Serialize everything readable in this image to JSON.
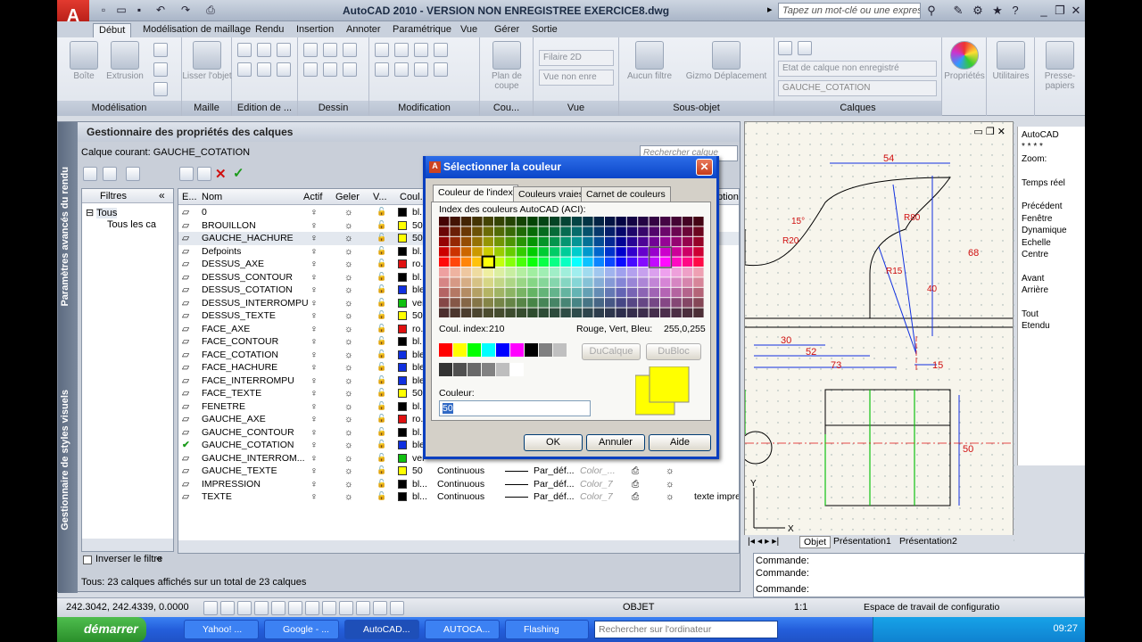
{
  "titlebar": {
    "title": "AutoCAD 2010 - VERSION NON ENREGISTREE    EXERCICE8.dwg",
    "search_placeholder": "Tapez un mot-clé ou une expressio"
  },
  "ribbon": {
    "tabs": [
      "Début",
      "Modélisation de maillage",
      "Rendu",
      "Insertion",
      "Annoter",
      "Paramétrique",
      "Vue",
      "Gérer",
      "Sortie"
    ],
    "buttons": {
      "boite": "Boîte",
      "extrusion": "Extrusion",
      "lisser": "Lisser l'objet",
      "plan_de_coupe": "Plan de coupe",
      "aucun_filtre": "Aucun filtre",
      "gizmo": "Gizmo Déplacement",
      "proprietes": "Propriétés",
      "utilitaires": "Utilitaires",
      "presse_papiers": "Presse-papiers"
    },
    "combos": {
      "style_visuel": "Filaire 2D",
      "vue": "Vue non enre",
      "etat_calque": "Etat de calque non enregistré",
      "calque_courant": "GAUCHE_COTATION"
    },
    "panels": [
      "Modélisation",
      "Maille",
      "Edition de ...",
      "Dessin",
      "Modification",
      "Cou...",
      "Vue",
      "Sous-objet",
      "Calques"
    ]
  },
  "layer_manager": {
    "side_labels": [
      "Paramètres avancés du rendu",
      "Gestionnaire de styles visuels"
    ],
    "title": "Gestionnaire des propriétés des calques",
    "current_layer": "Calque courant: GAUCHE_COTATION",
    "search_placeholder": "Rechercher calque",
    "filters_title": "Filtres",
    "filter_tree": [
      "Tous",
      "Tous les ca"
    ],
    "invert_filter": "Inverser le filtre",
    "columns": [
      "E...",
      "Nom",
      "Actif",
      "Geler",
      "V...",
      "Coul...",
      "",
      "",
      "",
      "",
      "ption"
    ],
    "rows": [
      {
        "name": "0",
        "color": "#000000",
        "color_label": "bl..."
      },
      {
        "name": "BROUILLON",
        "color": "#ffff00",
        "color_label": "50"
      },
      {
        "name": "GAUCHE_HACHURE",
        "color": "#ffff00",
        "color_label": "50"
      },
      {
        "name": "Defpoints",
        "color": "#000000",
        "color_label": "bl..."
      },
      {
        "name": "DESSUS_AXE",
        "color": "#e01010",
        "color_label": "ro..."
      },
      {
        "name": "DESSUS_CONTOUR",
        "color": "#000000",
        "color_label": "bl..."
      },
      {
        "name": "DESSUS_COTATION",
        "color": "#1030e0",
        "color_label": "ble"
      },
      {
        "name": "DESSUS_INTERROMPU",
        "color": "#10c010",
        "color_label": "ver"
      },
      {
        "name": "DESSUS_TEXTE",
        "color": "#ffff00",
        "color_label": "50"
      },
      {
        "name": "FACE_AXE",
        "color": "#e01010",
        "color_label": "ro..."
      },
      {
        "name": "FACE_CONTOUR",
        "color": "#000000",
        "color_label": "bl..."
      },
      {
        "name": "FACE_COTATION",
        "color": "#1030e0",
        "color_label": "ble"
      },
      {
        "name": "FACE_HACHURE",
        "color": "#1030e0",
        "color_label": "ble"
      },
      {
        "name": "FACE_INTERROMPU",
        "color": "#1030e0",
        "color_label": "ble"
      },
      {
        "name": "FACE_TEXTE",
        "color": "#ffff00",
        "color_label": "50"
      },
      {
        "name": "FENETRE",
        "color": "#000000",
        "color_label": "bl..."
      },
      {
        "name": "GAUCHE_AXE",
        "color": "#e01010",
        "color_label": "ro..."
      },
      {
        "name": "GAUCHE_CONTOUR",
        "color": "#000000",
        "color_label": "bl..."
      },
      {
        "name": "GAUCHE_COTATION",
        "color": "#1030e0",
        "color_label": "ble",
        "current": true
      },
      {
        "name": "GAUCHE_INTERROM...",
        "color": "#10c010",
        "color_label": "ver"
      },
      {
        "name": "GAUCHE_TEXTE",
        "color": "#ffff00",
        "color_label": "50",
        "linetype": "Continuous",
        "lineweight": "Par_déf...",
        "plotstyle": "Color_..."
      },
      {
        "name": "IMPRESSION",
        "color": "#000000",
        "color_label": "bl...",
        "linetype": "Continuous",
        "lineweight": "Par_déf...",
        "plotstyle": "Color_7"
      },
      {
        "name": "TEXTE",
        "color": "#000000",
        "color_label": "bl...",
        "linetype": "Continuous",
        "lineweight": "Par_déf...",
        "plotstyle": "Color_7",
        "description": "texte impre"
      }
    ],
    "status": "Tous: 23 calques affichés sur un total de 23 calques"
  },
  "dialog": {
    "title": "Sélectionner la couleur",
    "tabs": [
      "Couleur de l'index",
      "Couleurs vraies",
      "Carnet de couleurs"
    ],
    "index_label": "Index des couleurs AutoCAD (ACI):",
    "coul_index_label": "Coul. index:",
    "coul_index_value": "210",
    "rgb_label": "Rouge, Vert, Bleu:",
    "rgb_value": "255,0,255",
    "bylayer": "DuCalque",
    "byblock": "DuBloc",
    "couleur_label": "Couleur:",
    "couleur_value": "50",
    "ok": "OK",
    "cancel": "Annuler",
    "help": "Aide",
    "preview_color": "#ffff00"
  },
  "drawing": {
    "dims": [
      "54",
      "15°",
      "R20",
      "R80",
      "R15",
      "68",
      "40",
      "30",
      "52",
      "73",
      "15",
      "50"
    ],
    "ucs_x": "X",
    "ucs_y": "Y",
    "tabs": [
      "Objet",
      "Présentation1",
      "Présentation2"
    ]
  },
  "right_panel": [
    "AutoCAD",
    "* * * *",
    "Zoom:",
    "",
    "Temps réel",
    "",
    "Précédent",
    "Fenêtre",
    "Dynamique",
    "Echelle",
    "Centre",
    "",
    "Avant",
    "Arrière",
    "",
    "Tout",
    "Etendu"
  ],
  "command": [
    "Commande:",
    "Commande:",
    "Commande:"
  ],
  "statusbar": {
    "coords": "242.3042, 242.4339, 0.0000",
    "objet": "OBJET",
    "scale": "1:1",
    "workspace": "Espace de travail de configuratio"
  },
  "taskbar": {
    "start": "démarrer",
    "tasks": [
      "Yahoo! ...",
      "Google - ...",
      "AutoCAD...",
      "AUTOCA...",
      "Flashing"
    ],
    "search_placeholder": "Rechercher sur l'ordinateur",
    "clock": "09:27"
  }
}
